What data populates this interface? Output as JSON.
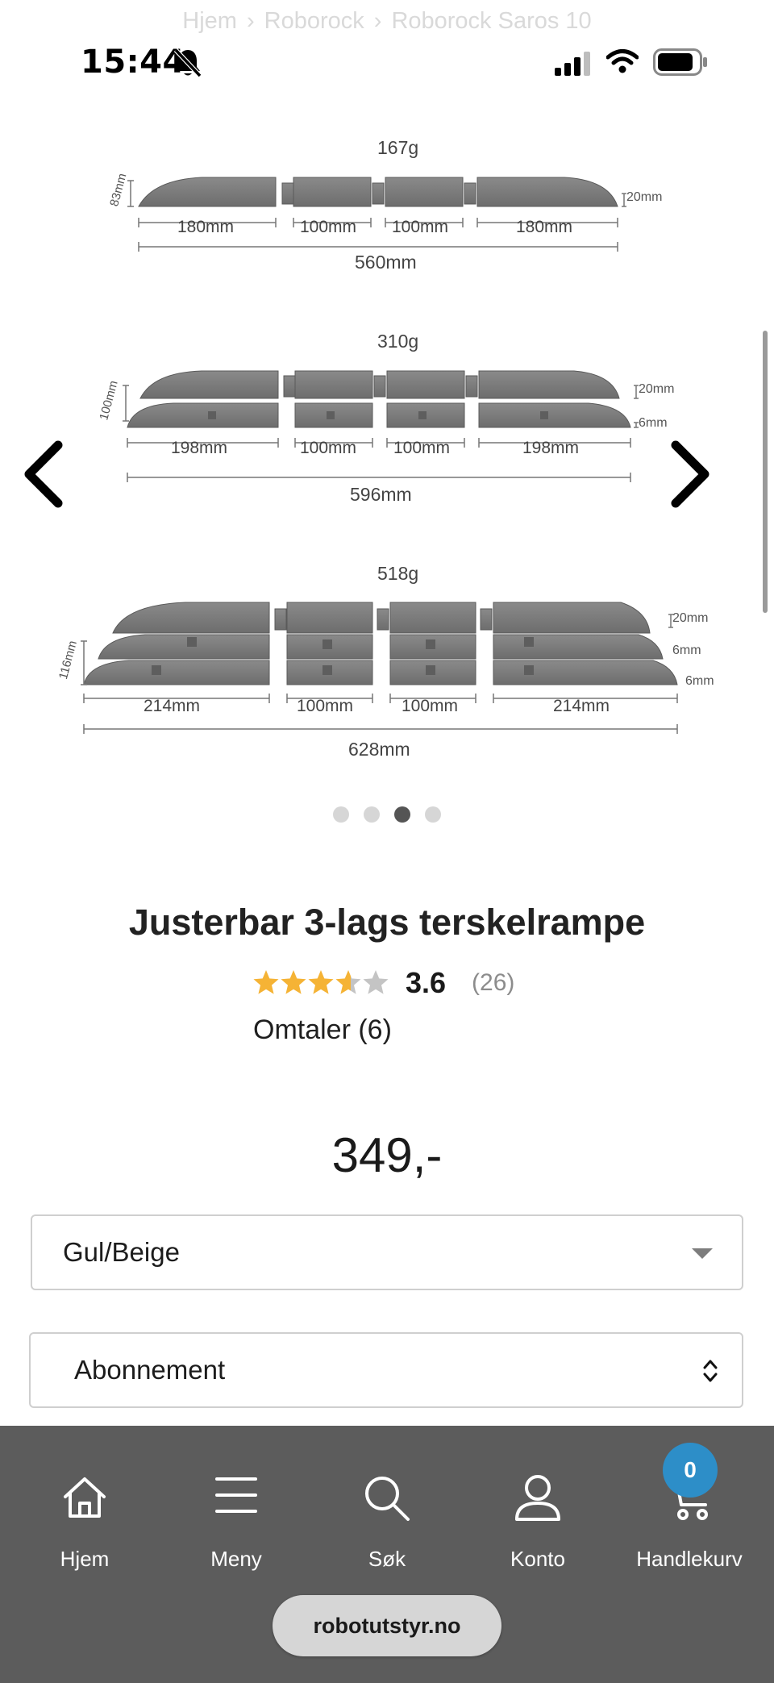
{
  "breadcrumb": [
    "Hjem",
    "Roborock",
    "Roborock Saros 10"
  ],
  "status": {
    "time": "15:44"
  },
  "gallery": {
    "ramps": [
      {
        "weight": "167g",
        "height": "83mm",
        "side_thickness": [
          "20mm"
        ],
        "segments": [
          "180mm",
          "100mm",
          "100mm",
          "180mm"
        ],
        "total": "560mm"
      },
      {
        "weight": "310g",
        "height": "100mm",
        "side_thickness": [
          "20mm",
          "6mm"
        ],
        "segments": [
          "198mm",
          "100mm",
          "100mm",
          "198mm"
        ],
        "total": "596mm"
      },
      {
        "weight": "518g",
        "height": "116mm",
        "side_thickness": [
          "20mm",
          "6mm",
          "6mm"
        ],
        "segments": [
          "214mm",
          "100mm",
          "100mm",
          "214mm"
        ],
        "total": "628mm"
      }
    ],
    "dot_count": 4,
    "active_dot": 3
  },
  "product": {
    "title": "Justerbar 3-lags terskelrampe",
    "rating": "3.6",
    "rating_value": 3.6,
    "rating_count": "(26)",
    "reviews_link": "Omtaler (6)",
    "price": "349,-"
  },
  "options": {
    "color_selected": "Gul/Beige",
    "purchase_selected": "Abonnement"
  },
  "nav": {
    "items": [
      {
        "label": "Hjem",
        "icon": "home-icon"
      },
      {
        "label": "Meny",
        "icon": "menu-icon"
      },
      {
        "label": "Søk",
        "icon": "search-icon"
      },
      {
        "label": "Konto",
        "icon": "user-icon"
      },
      {
        "label": "Handlekurv",
        "icon": "cart-icon"
      }
    ],
    "cart_count": "0"
  },
  "url": "robotutstyr.no",
  "colors": {
    "star": "#f5b335",
    "star_empty": "#c4c4c4",
    "nav_bg": "#5c5c5c",
    "badge": "#2d8ec8"
  }
}
